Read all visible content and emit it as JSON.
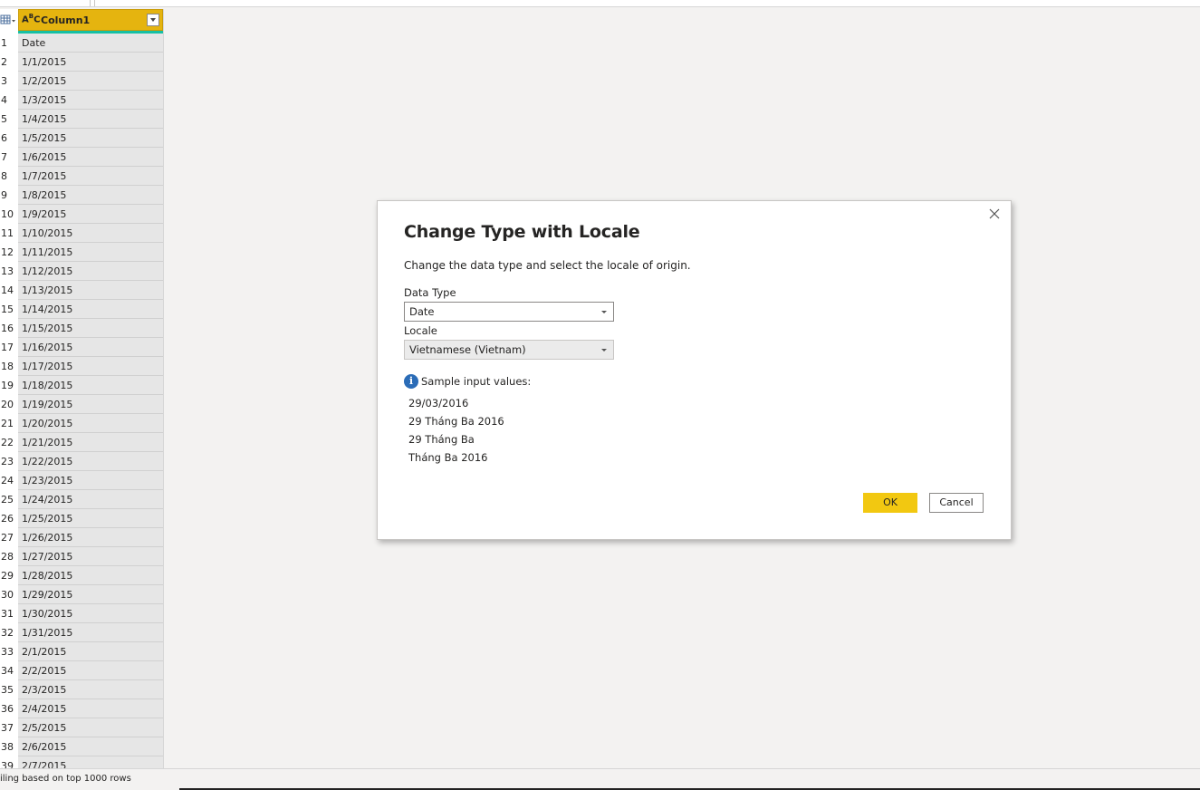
{
  "grid": {
    "column_type_icon": "text-type-abc-icon",
    "column_header": "Column1",
    "rows": [
      {
        "n": "1",
        "v": "Date"
      },
      {
        "n": "2",
        "v": "1/1/2015"
      },
      {
        "n": "3",
        "v": "1/2/2015"
      },
      {
        "n": "4",
        "v": "1/3/2015"
      },
      {
        "n": "5",
        "v": "1/4/2015"
      },
      {
        "n": "6",
        "v": "1/5/2015"
      },
      {
        "n": "7",
        "v": "1/6/2015"
      },
      {
        "n": "8",
        "v": "1/7/2015"
      },
      {
        "n": "9",
        "v": "1/8/2015"
      },
      {
        "n": "10",
        "v": "1/9/2015"
      },
      {
        "n": "11",
        "v": "1/10/2015"
      },
      {
        "n": "12",
        "v": "1/11/2015"
      },
      {
        "n": "13",
        "v": "1/12/2015"
      },
      {
        "n": "14",
        "v": "1/13/2015"
      },
      {
        "n": "15",
        "v": "1/14/2015"
      },
      {
        "n": "16",
        "v": "1/15/2015"
      },
      {
        "n": "17",
        "v": "1/16/2015"
      },
      {
        "n": "18",
        "v": "1/17/2015"
      },
      {
        "n": "19",
        "v": "1/18/2015"
      },
      {
        "n": "20",
        "v": "1/19/2015"
      },
      {
        "n": "21",
        "v": "1/20/2015"
      },
      {
        "n": "22",
        "v": "1/21/2015"
      },
      {
        "n": "23",
        "v": "1/22/2015"
      },
      {
        "n": "24",
        "v": "1/23/2015"
      },
      {
        "n": "25",
        "v": "1/24/2015"
      },
      {
        "n": "26",
        "v": "1/25/2015"
      },
      {
        "n": "27",
        "v": "1/26/2015"
      },
      {
        "n": "28",
        "v": "1/27/2015"
      },
      {
        "n": "29",
        "v": "1/28/2015"
      },
      {
        "n": "30",
        "v": "1/29/2015"
      },
      {
        "n": "31",
        "v": "1/30/2015"
      },
      {
        "n": "32",
        "v": "1/31/2015"
      },
      {
        "n": "33",
        "v": "2/1/2015"
      },
      {
        "n": "34",
        "v": "2/2/2015"
      },
      {
        "n": "35",
        "v": "2/3/2015"
      },
      {
        "n": "36",
        "v": "2/4/2015"
      },
      {
        "n": "37",
        "v": "2/5/2015"
      },
      {
        "n": "38",
        "v": "2/6/2015"
      },
      {
        "n": "39",
        "v": "2/7/2015"
      }
    ]
  },
  "status_bar": {
    "text": "iling based on top 1000 rows"
  },
  "dialog": {
    "title": "Change Type with Locale",
    "subtitle": "Change the data type and select the locale of origin.",
    "data_type_label": "Data Type",
    "data_type_value": "Date",
    "locale_label": "Locale",
    "locale_value": "Vietnamese (Vietnam)",
    "sample_header": "Sample input values:",
    "samples": [
      "29/03/2016",
      "29 Tháng Ba 2016",
      "29 Tháng Ba",
      "Tháng Ba 2016"
    ],
    "ok_label": "OK",
    "cancel_label": "Cancel"
  },
  "colors": {
    "column_header_bg": "#e5b40f",
    "quality_bar": "#16c0a4",
    "ok_button": "#f2c811",
    "info_icon": "#2b6cb7"
  }
}
